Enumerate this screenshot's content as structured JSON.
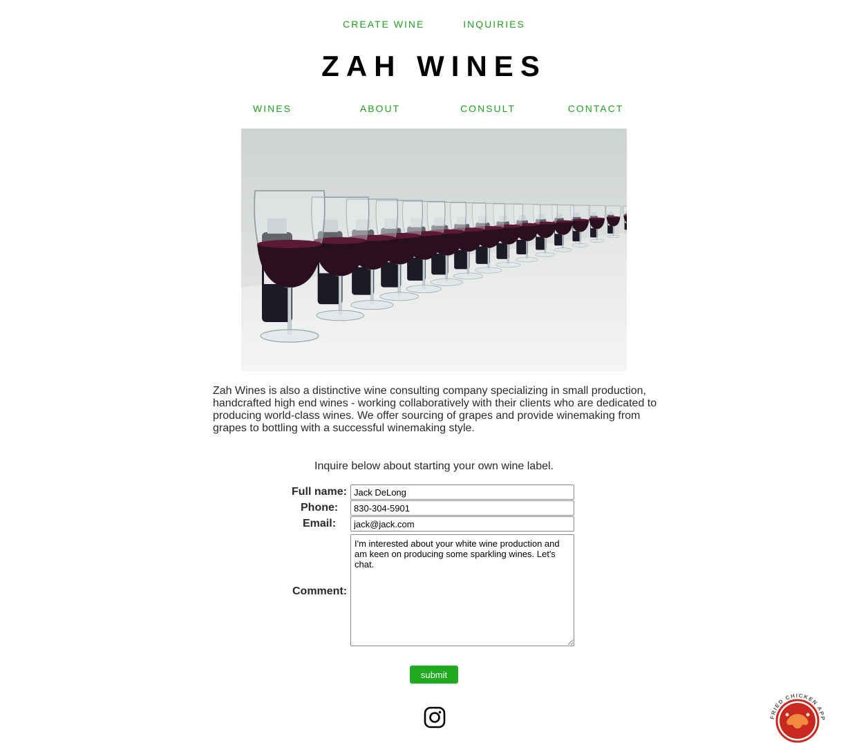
{
  "top_nav": {
    "create_wine": "CREATE WINE",
    "inquiries": "INQUIRIES"
  },
  "site_title": "ZAH WINES",
  "main_nav": [
    "WINES",
    "ABOUT",
    "CONSULT",
    "CONTACT"
  ],
  "hero_image": {
    "description": "wine-glasses-row-photo"
  },
  "description": "Zah Wines is also a distinctive wine consulting company specializing in small production, handcrafted high end wines - working collaboratively with their clients who are dedicated to producing world-class wines. We offer sourcing of grapes and provide winemaking from grapes to bottling with a successful winemaking style.",
  "form": {
    "intro": "Inquire below about starting your own wine label.",
    "full_name_label": "Full name:",
    "full_name_value": "Jack DeLong",
    "phone_label": "Phone:",
    "phone_value": "830-304-5901",
    "email_label": "Email:",
    "email_value": "jack@jack.com",
    "comment_label": "Comment:",
    "comment_value": "I'm interested about your white wine production and am keen on producing some sparkling wines. Let's chat.",
    "submit_label": "submit"
  },
  "footer": {
    "social_icon": "instagram-icon",
    "badge_text": "FRIED CHICKEN APPROVED"
  },
  "colors": {
    "accent_green": "#1fa01f",
    "button_green": "#1faa1f",
    "badge_red": "#c8281e"
  }
}
